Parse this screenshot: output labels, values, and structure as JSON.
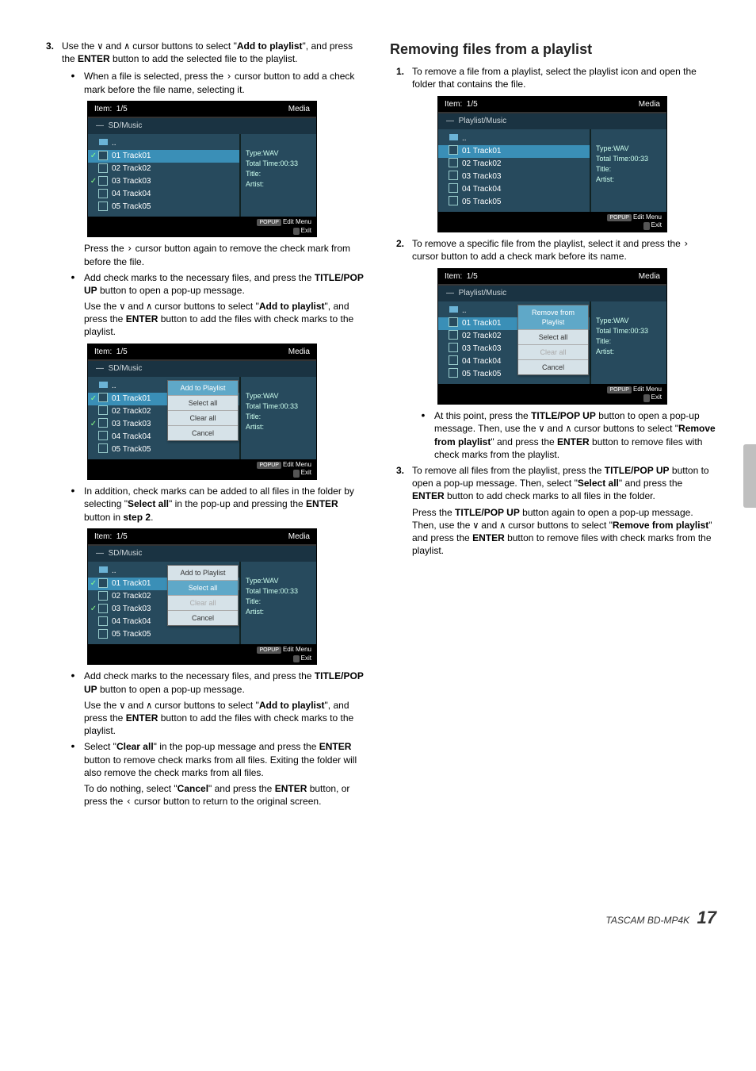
{
  "left": {
    "step3": {
      "num": "3.",
      "text_a": "Use the ",
      "text_b": " and ",
      "text_c": " cursor buttons to select \"",
      "bold1": "Add to playlist",
      "text_d": "\", and press the ",
      "bold2": "ENTER",
      "text_e": " button to add the selected file to the playlist."
    },
    "bul_a1": "When a file is selected, press the ",
    "bul_a2": " cursor button to add a check mark before the file name, selecting it.",
    "after_shot1_a": "Press the ",
    "after_shot1_b": " cursor button again to remove the check mark from before the file.",
    "bul_b1": "Add check marks to the necessary files, and press the ",
    "bul_b_bold": "TITLE/POP UP",
    "bul_b2": " button to open a pop-up message.",
    "bul_b3": "Use the ",
    "bul_b4": " and ",
    "bul_b5": " cursor buttons to select \"",
    "bul_b_bold2": "Add to playlist",
    "bul_b6": "\", and press the ",
    "bul_b_bold3": "ENTER",
    "bul_b7": " button to add the files with check marks to the playlist.",
    "bul_c1": "In addition, check marks can be added to all files in the folder by selecting \"",
    "bul_c_bold": "Select all",
    "bul_c2": "\" in the pop-up and pressing the ",
    "bul_c_bold2": "ENTER",
    "bul_c3": " button in ",
    "bul_c_bold3": "step 2",
    "bul_c4": ".",
    "bul_d1": "Add check marks to the necessary files, and press the ",
    "bul_d_bold": "TITLE/POP UP",
    "bul_d2": " button to open a pop-up message.",
    "bul_d3": "Use the ",
    "bul_d4": " and ",
    "bul_d5": " cursor buttons to select \"",
    "bul_d_bold2": "Add to playlist",
    "bul_d6": "\", and press the ",
    "bul_d_bold3": "ENTER",
    "bul_d7": " button to add the files with check marks to the playlist.",
    "bul_e1": "Select \"",
    "bul_e_bold": "Clear all",
    "bul_e2": "\" in the pop-up message and press the ",
    "bul_e_bold2": "ENTER",
    "bul_e3": " button to remove check marks from all files. Exiting the folder will also remove the check marks from all files.",
    "bul_e4": "To do nothing, select \"",
    "bul_e_bold3": "Cancel",
    "bul_e5": "\" and press the ",
    "bul_e_bold4": "ENTER",
    "bul_e6": " button, or press the ",
    "bul_e7": " cursor button to return to the original screen."
  },
  "right": {
    "heading": "Removing files from a playlist",
    "step1": {
      "num": "1.",
      "text": "To remove a file from a playlist, select the playlist icon and open the folder that contains the file."
    },
    "step2": {
      "num": "2.",
      "a": "To remove a specific file from the playlist, select it and press the ",
      "b": " cursor button to add a check mark before its name."
    },
    "bul_a1": "At this point, press the ",
    "bul_a_bold": "TITLE/POP UP",
    "bul_a2": " button to open a pop-up message. Then, use the ",
    "bul_a3": " and ",
    "bul_a4": " cursor buttons to select \"",
    "bul_a_bold2": "Remove from playlist",
    "bul_a5": "\" and press the ",
    "bul_a_bold3": "ENTER",
    "bul_a6": " button to remove files with check marks from the playlist.",
    "step3": {
      "num": "3.",
      "a": "To remove all files from the playlist, press the ",
      "b": "TITLE/POP UP",
      "c": " button to open a pop-up message. Then, select \"",
      "d": "Select all",
      "e": "\" and press the ",
      "f": "ENTER",
      "g": " button to add check marks to all files in the folder.",
      "h": "Press the ",
      "i": "TITLE/POP UP",
      "j": " button again to open a pop-up message. Then, use the ",
      "k": " and ",
      "l": " cursor buttons to select \"",
      "m": "Remove from playlist",
      "n": "\" and press the ",
      "o": "ENTER",
      "p": " button to remove files with check marks from the playlist."
    }
  },
  "shots": {
    "header_item": "Item:",
    "header_num": "1/5",
    "header_media": "Media",
    "crumb_sd": "SD/Music",
    "crumb_pl": "Playlist/Music",
    "dots": "..",
    "tracks": [
      "01 Track01",
      "02 Track02",
      "03 Track03",
      "04 Track04",
      "05 Track05"
    ],
    "info": {
      "type": "Type:WAV",
      "time": "Total Time:00:33",
      "title": "Title:",
      "artist": "Artist:"
    },
    "footer_popup": "POPUP",
    "footer_edit": "Edit Menu",
    "footer_exit": "Exit",
    "popup_add": {
      "add": "Add to Playlist",
      "sel": "Select all",
      "clr": "Clear all",
      "can": "Cancel"
    },
    "popup_rem": {
      "rem": "Remove from Playlist",
      "sel": "Select all",
      "clr": "Clear all",
      "can": "Cancel"
    }
  },
  "footer": {
    "brand": "TASCAM BD-MP4K",
    "page": "17"
  },
  "glyph": {
    "up": "∧",
    "down": "∨",
    "right": "›",
    "left": "‹",
    "check": "✓"
  }
}
